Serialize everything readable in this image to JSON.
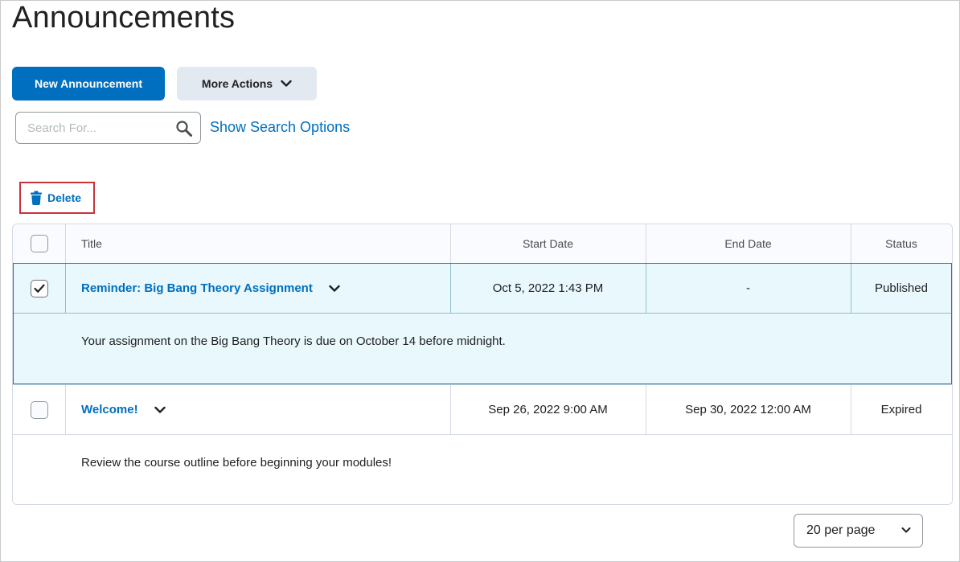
{
  "page": {
    "title": "Announcements"
  },
  "toolbar": {
    "new_label": "New Announcement",
    "more_label": "More Actions"
  },
  "search": {
    "placeholder": "Search For...",
    "value": "",
    "options_link": "Show Search Options"
  },
  "bulk_actions": {
    "delete_label": "Delete"
  },
  "table": {
    "headers": {
      "title": "Title",
      "start_date": "Start Date",
      "end_date": "End Date",
      "status": "Status"
    },
    "rows": [
      {
        "checked": true,
        "title": "Reminder: Big Bang Theory Assignment",
        "start_date": "Oct 5, 2022 1:43 PM",
        "end_date": "-",
        "status": "Published",
        "body": "Your assignment on the Big Bang Theory is due on October 14 before midnight."
      },
      {
        "checked": false,
        "title": "Welcome!",
        "start_date": "Sep 26, 2022 9:00 AM",
        "end_date": "Sep 30, 2022 12:00 AM",
        "status": "Expired",
        "body": "Review the course outline before beginning your modules!"
      }
    ]
  },
  "pagination": {
    "per_page": "20 per page"
  },
  "colors": {
    "primary": "#006fbf",
    "selected_row": "#e9f8fc",
    "highlight_border": "#c8343a"
  }
}
